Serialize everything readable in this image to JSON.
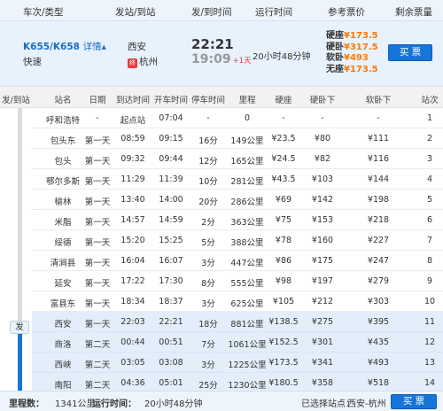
{
  "header": {
    "train_type": "车次/类型",
    "stations": "发站/到站",
    "times": "发/到时间",
    "duration": "运行时间",
    "price": "参考票价",
    "remaining": "剩余票量"
  },
  "summary": {
    "train_no": "K655/K658",
    "detail_link": "详情",
    "detail_arrow": "▴",
    "train_type": "快速",
    "from_station": "西安",
    "to_station": "杭州",
    "end_mark": "终",
    "dep_time": "22:21",
    "arr_time": "19:09",
    "plus_day": "+1天",
    "duration": "20小时48分钟",
    "prices": [
      {
        "label": "硬座",
        "value": "¥173.5"
      },
      {
        "label": "硬卧",
        "value": "¥317.5"
      },
      {
        "label": "软卧",
        "value": "¥493"
      },
      {
        "label": "无座",
        "value": "¥173.5"
      }
    ],
    "buy_button": "买 票"
  },
  "stops": {
    "columns": [
      "发/到站",
      "站名",
      "日期",
      "到达时间",
      "开车时间",
      "停车时间",
      "里程",
      "硬座",
      "硬卧下",
      "软卧下",
      "站次"
    ],
    "depart_badge": "发",
    "rows": [
      [
        "呼和浩特",
        "-",
        "起点站",
        "07:04",
        "-",
        "0",
        "-",
        "-",
        "-",
        "1"
      ],
      [
        "包头东",
        "第一天",
        "08:59",
        "09:15",
        "16分",
        "149公里",
        "¥23.5",
        "¥80",
        "¥111",
        "2"
      ],
      [
        "包头",
        "第一天",
        "09:32",
        "09:44",
        "12分",
        "165公里",
        "¥24.5",
        "¥82",
        "¥116",
        "3"
      ],
      [
        "鄂尔多斯",
        "第一天",
        "11:29",
        "11:39",
        "10分",
        "281公里",
        "¥43.5",
        "¥103",
        "¥144",
        "4"
      ],
      [
        "榆林",
        "第一天",
        "13:40",
        "14:00",
        "20分",
        "286公里",
        "¥69",
        "¥142",
        "¥198",
        "5"
      ],
      [
        "米脂",
        "第一天",
        "14:57",
        "14:59",
        "2分",
        "363公里",
        "¥75",
        "¥153",
        "¥218",
        "6"
      ],
      [
        "绥德",
        "第一天",
        "15:20",
        "15:25",
        "5分",
        "388公里",
        "¥78",
        "¥160",
        "¥227",
        "7"
      ],
      [
        "清涧县",
        "第一天",
        "16:04",
        "16:07",
        "3分",
        "447公里",
        "¥86",
        "¥175",
        "¥247",
        "8"
      ],
      [
        "延安",
        "第一天",
        "17:22",
        "17:30",
        "8分",
        "555公里",
        "¥98",
        "¥197",
        "¥279",
        "9"
      ],
      [
        "富县东",
        "第一天",
        "18:34",
        "18:37",
        "3分",
        "625公里",
        "¥105",
        "¥212",
        "¥303",
        "10"
      ],
      [
        "西安",
        "第一天",
        "22:03",
        "22:21",
        "18分",
        "881公里",
        "¥138.5",
        "¥275",
        "¥395",
        "11"
      ],
      [
        "商洛",
        "第二天",
        "00:44",
        "00:51",
        "7分",
        "1061公里",
        "¥152.5",
        "¥301",
        "¥435",
        "12"
      ],
      [
        "西峡",
        "第二天",
        "03:05",
        "03:08",
        "3分",
        "1225公里",
        "¥173.5",
        "¥341",
        "¥493",
        "13"
      ],
      [
        "南阳",
        "第二天",
        "04:36",
        "05:01",
        "25分",
        "1230公里",
        "¥180.5",
        "¥358",
        "¥518",
        "14"
      ]
    ]
  },
  "footer": {
    "distance_label": "里程数：",
    "distance": "1341公里",
    "runtime_label": "运行时间：",
    "runtime": "20小时48分钟",
    "selected_label": "已选择站点：",
    "selected": "西安-杭州",
    "buy_button": "买 票"
  }
}
